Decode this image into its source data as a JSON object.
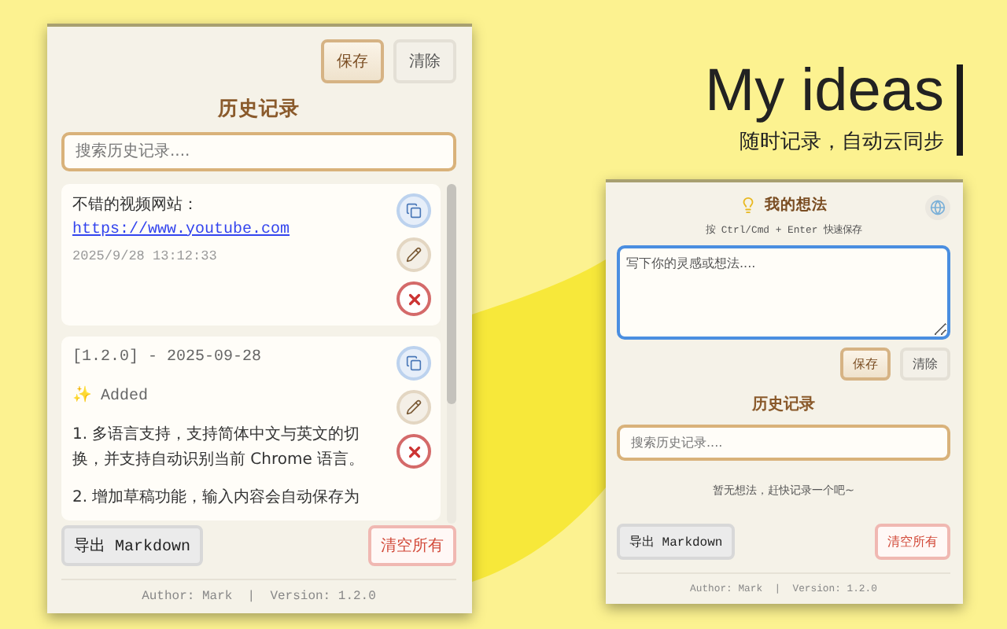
{
  "hero": {
    "title": "My ideas",
    "subtitle": "随时记录，自动云同步"
  },
  "panels": [
    {
      "actions": [
        "保存",
        "清除"
      ],
      "history": {
        "title": "历史记录",
        "search_placeholder": "搜索历史记录....",
        "items": [
          {
            "blocks": [
              {
                "kind": "text",
                "text": "不错的视频网站："
              },
              {
                "kind": "link",
                "text": "https://www.youtube.com"
              }
            ],
            "date": "2025/9/28 13:12:33"
          },
          {
            "blocks": [
              {
                "kind": "mono",
                "text": "[1.2.0] - 2025-09-28"
              },
              {
                "kind": "mono",
                "text": "✨ Added"
              },
              {
                "kind": "text",
                "text": "1. 多语言支持，支持简体中文与英文的切换，并支持自动识别当前 Chrome 语言。"
              },
              {
                "kind": "text",
                "text": "2. 增加草稿功能，输入内容会自动保存为"
              }
            ]
          }
        ]
      },
      "export": "导出 Markdown",
      "clear_all": "清空所有",
      "author": "Author: Mark  |  Version: 1.2.0"
    },
    {
      "header": {
        "title": "我的想法",
        "hint": "按 Ctrl/Cmd + Enter 快速保存"
      },
      "editor": {
        "placeholder": "写下你的灵感或想法...."
      },
      "actions": [
        "保存",
        "清除"
      ],
      "history": {
        "title": "历史记录",
        "search_placeholder": "搜索历史记录....",
        "empty": "暂无想法，赶快记录一个吧~"
      },
      "export": "导出 Markdown",
      "clear_all": "清空所有",
      "author": "Author: Mark  |  Version: 1.2.0"
    }
  ]
}
